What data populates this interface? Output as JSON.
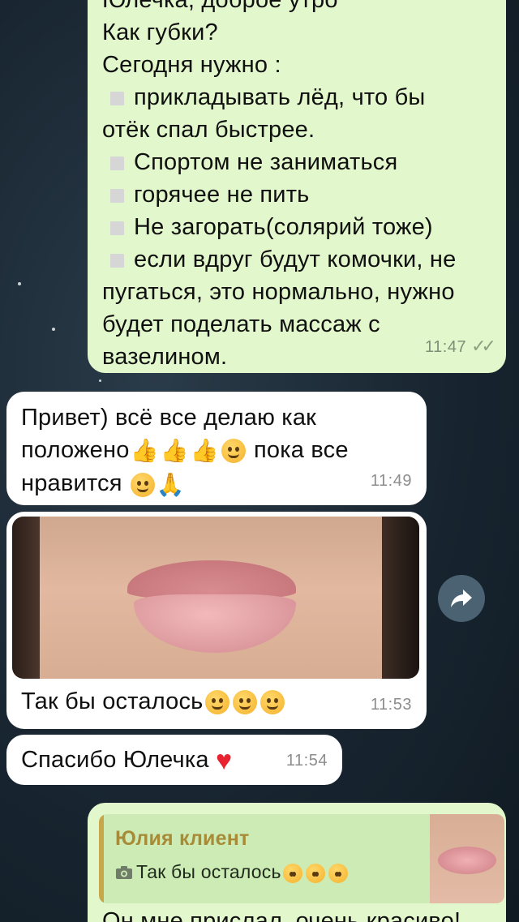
{
  "messages": {
    "m1": {
      "lines": [
        "Юлечка, доброе утро",
        "Как губки?",
        "Сегодня нужно :",
        "прикладывать лёд, что бы",
        "отёк спал быстрее.",
        "Спортом не заниматься",
        "горячее не пить",
        "Не загорать(солярий тоже)",
        "если вдруг будут комочки, не",
        "пугаться, это нормально, нужно",
        "будет поделать массаж с",
        "вазелином."
      ],
      "time": "11:47"
    },
    "m2": {
      "line1": "Привет) всё все делаю как",
      "line2a": "положено",
      "line2b": "пока все",
      "line3": "нравится",
      "time": "11:49"
    },
    "m3": {
      "caption": "Так бы осталось",
      "time": "11:53"
    },
    "m4": {
      "text": "Спасибо Юлечка",
      "time": "11:54"
    },
    "m5": {
      "reply_name": "Юлия клиент",
      "reply_text": "Так бы осталось",
      "text": "Он мне прислал, очень красиво!"
    }
  },
  "icons": {
    "forward": "share-arrow-icon",
    "camera": "camera-icon",
    "checks": "double-check-icon"
  },
  "colors": {
    "outgoing_bubble": "#e2f7cb",
    "incoming_bubble": "#ffffff",
    "background": "#1b2a36",
    "reply_accent": "#c7a74a"
  }
}
